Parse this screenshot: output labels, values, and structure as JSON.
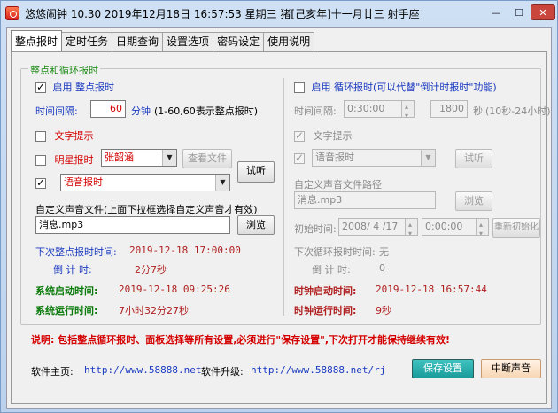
{
  "window": {
    "title": "悠悠闹钟 10.30 2019年12月18日 16:57:53 星期三 猪[己亥年]十一月廿三 射手座",
    "min_glyph": "—",
    "max_glyph": "☐",
    "close_glyph": "✕"
  },
  "tabs": [
    {
      "label": "整点报时"
    },
    {
      "label": "定时任务"
    },
    {
      "label": "日期查询"
    },
    {
      "label": "设置选项"
    },
    {
      "label": "密码设定"
    },
    {
      "label": "使用说明"
    }
  ],
  "group_title": "整点和循环报时",
  "left": {
    "enable_hourly_label": "启用 整点报时",
    "interval_label": "时间间隔:",
    "interval_value": "60",
    "interval_unit": "分钟",
    "interval_hint": "(1-60,60表示整点报时)",
    "text_prompt_label": "文字提示",
    "celebrity_label": "明星报时",
    "celebrity_value": "张韶涵",
    "view_file_label": "查看文件",
    "listen_label": "试听",
    "voice_value": "语音报时",
    "custom_file_label": "自定义声音文件(上面下拉框选择自定义声音才有效)",
    "custom_file_value": "消息.mp3",
    "browse_label": "浏览",
    "next_hourly_label": "下次整点报时时间:",
    "next_hourly_value": "2019-12-18 17:00:00",
    "countdown_label": "倒 计 时:",
    "countdown_value": "2分7秒",
    "sys_start_label": "系统启动时间:",
    "sys_start_value": "2019-12-18 09:25:26",
    "sys_run_label": "系统运行时间:",
    "sys_run_value": "7小时32分27秒"
  },
  "right": {
    "enable_loop_label": "启用 循环报时(可以代替\"倒计时报时\"功能)",
    "interval_label": "时间间隔:",
    "interval_time": "0:30:00",
    "interval_seconds": "1800",
    "interval_unit": "秒",
    "interval_hint": "(10秒-24小时)",
    "text_prompt_label": "文字提示",
    "voice_value": "语音报时",
    "listen_label": "试听",
    "custom_path_label": "自定义声音文件路径",
    "custom_path_value": "消息.mp3",
    "browse_label": "浏览",
    "init_time_label": "初始时间:",
    "init_date": "2008/ 4 /17",
    "init_time": "0:00:00",
    "reinit_label": "重新初始化",
    "next_loop_label": "下次循环报时时间:",
    "next_loop_value": "无",
    "countdown_label": "倒 计 时:",
    "countdown_value": "0",
    "clock_start_label": "时钟启动时间:",
    "clock_start_value": "2019-12-18 16:57:44",
    "clock_run_label": "时钟运行时间:",
    "clock_run_value": "9秒"
  },
  "note": "说明: 包括整点循环报时、面板选择等所有设置,必须进行\"保存设置\",下次打开才能保持继续有效!",
  "footer": {
    "home_label": "软件主页:",
    "home_url": "http://www.58888.net",
    "upgrade_label": "软件升级:",
    "upgrade_url": "http://www.58888.net/rj",
    "save_label": "保存设置",
    "stop_label": "中断声音"
  }
}
